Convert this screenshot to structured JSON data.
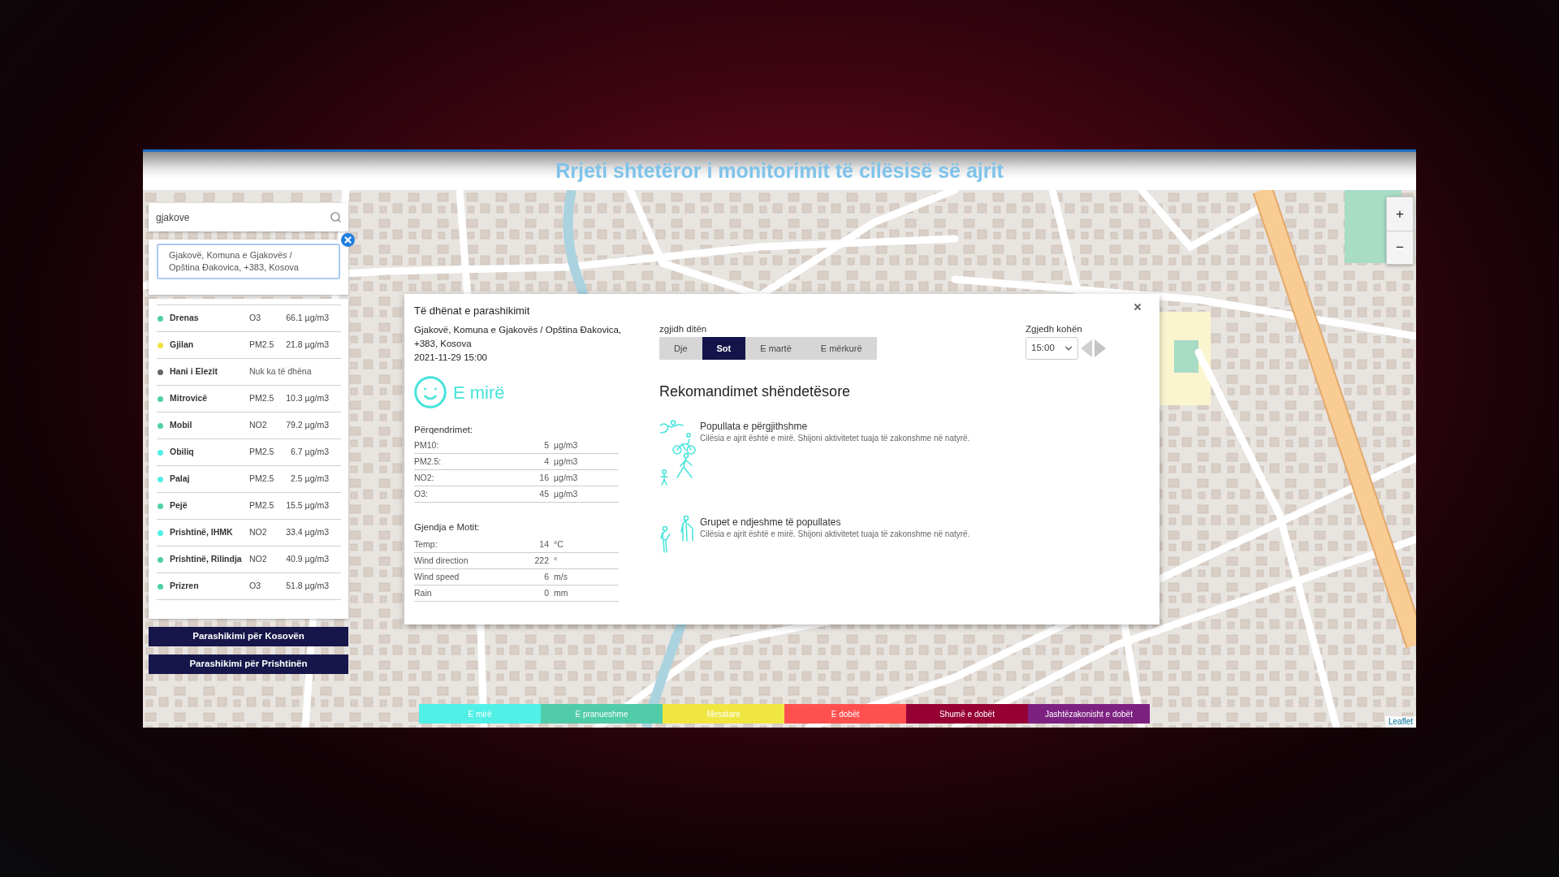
{
  "header": {
    "title": "Rrjeti shtetëror i monitorimit të cilësisë së ajrit"
  },
  "search": {
    "value": "gjakove",
    "results": [
      "Gjakovë, Komuna e Gjakovës / Opština Đakovica, +383, Kosova"
    ]
  },
  "stations": [
    {
      "kind": "reading",
      "name": "Drenas",
      "pollutant": "O3",
      "value": "66.1 µg/m3",
      "color": "#4fcfa6"
    },
    {
      "kind": "reading",
      "name": "Gjilan",
      "pollutant": "PM2.5",
      "value": "21.8 µg/m3",
      "color": "#f0e040"
    },
    {
      "kind": "no_data",
      "name": "Hani i Elezit",
      "status": "Nuk ka të dhëna",
      "color": "#666666"
    },
    {
      "kind": "reading",
      "name": "Mitrovicë",
      "pollutant": "PM2.5",
      "value": "10.3 µg/m3",
      "color": "#4fcfa6"
    },
    {
      "kind": "reading",
      "name": "Mobil",
      "pollutant": "NO2",
      "value": "79.2 µg/m3",
      "color": "#4fcfa6"
    },
    {
      "kind": "reading",
      "name": "Obiliq",
      "pollutant": "PM2.5",
      "value": "6.7 µg/m3",
      "color": "#50f0e6"
    },
    {
      "kind": "reading",
      "name": "Palaj",
      "pollutant": "PM2.5",
      "value": "2.5 µg/m3",
      "color": "#50f0e6"
    },
    {
      "kind": "reading",
      "name": "Pejë",
      "pollutant": "PM2.5",
      "value": "15.5 µg/m3",
      "color": "#4fcfa6"
    },
    {
      "kind": "reading",
      "name": "Prishtinë, IHMK",
      "pollutant": "NO2",
      "value": "33.4 µg/m3",
      "color": "#50f0e6"
    },
    {
      "kind": "reading",
      "name": "Prishtinë, Rilindja",
      "pollutant": "NO2",
      "value": "40.9 µg/m3",
      "color": "#4fcfa6"
    },
    {
      "kind": "reading",
      "name": "Prizren",
      "pollutant": "O3",
      "value": "51.8 µg/m3",
      "color": "#4fcfa6"
    }
  ],
  "forecast_buttons": [
    "Parashikimi për Kosovën",
    "Parashikimi për Prishtinën"
  ],
  "popup": {
    "title": "Të dhënat e parashikimit",
    "location": "Gjakovë, Komuna e Gjakovës / Opština Đakovica, +383, Kosova",
    "datetime": "2021-11-29 15:00",
    "air_quality": "E mirë",
    "concentrations": {
      "heading": "Përqendrimet:",
      "rows": [
        {
          "label": "PM10:",
          "value": "5",
          "unit": "µg/m3"
        },
        {
          "label": "PM2.5:",
          "value": "4",
          "unit": "µg/m3"
        },
        {
          "label": "NO2:",
          "value": "16",
          "unit": "µg/m3"
        },
        {
          "label": "O3:",
          "value": "45",
          "unit": "µg/m3"
        }
      ]
    },
    "weather": {
      "heading": "Gjendja e Motit:",
      "rows": [
        {
          "label": "Temp:",
          "value": "14",
          "unit": "°C"
        },
        {
          "label": "Wind direction",
          "value": "222",
          "unit": "°"
        },
        {
          "label": "Wind speed",
          "value": "6",
          "unit": "m/s"
        },
        {
          "label": "Rain",
          "value": "0",
          "unit": "mm"
        }
      ]
    },
    "day_picker": {
      "label": "zgjidh ditën",
      "days": [
        {
          "label": "Dje",
          "selected": false
        },
        {
          "label": "Sot",
          "selected": true
        },
        {
          "label": "E martë",
          "selected": false
        },
        {
          "label": "E mërkurë",
          "selected": false
        }
      ]
    },
    "time_picker": {
      "label": "Zgjedh kohën",
      "value": "15:00"
    },
    "recommendations": {
      "heading": "Rekomandimet shëndetësore",
      "items": [
        {
          "kind": "general",
          "title": "Popullata e përgjithshme",
          "text": "Cilësia e ajrit është e mirë. Shijoni aktivitetet tuaja të zakonshme në natyrë."
        },
        {
          "kind": "sensitive",
          "title": "Grupet e ndjeshme të popullates",
          "text": "Cilësia e ajrit është e mirë. Shijoni aktivitetet tuaja të zakonshme në natyrë."
        }
      ]
    }
  },
  "zoom_controls": [
    "+",
    "−"
  ],
  "legend": [
    {
      "label": "E mirë",
      "color": "#50f0e6"
    },
    {
      "label": "E pranueshme",
      "color": "#50cca8"
    },
    {
      "label": "Mesatare",
      "color": "#f0e641"
    },
    {
      "label": "E dobët",
      "color": "#ff5050"
    },
    {
      "label": "Shumë e dobët",
      "color": "#960032"
    },
    {
      "label": "Jashtëzakonisht e dobët",
      "color": "#7d2181"
    }
  ],
  "attribution": "Leaflet"
}
